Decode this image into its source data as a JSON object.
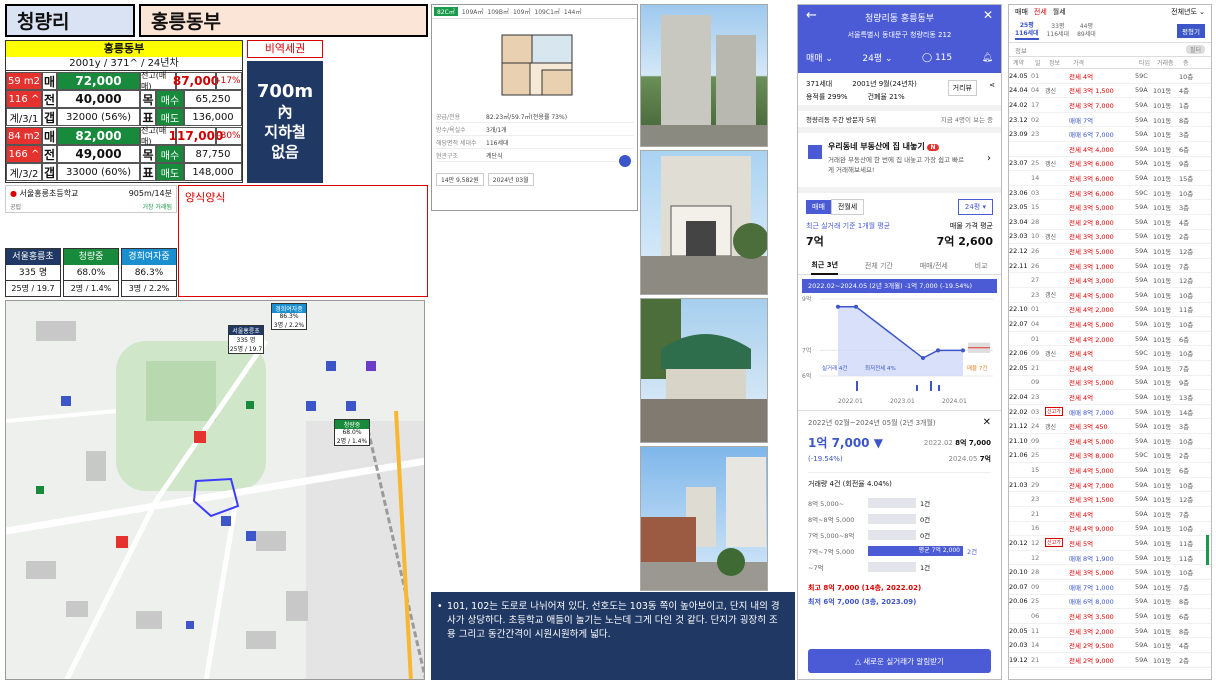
{
  "header": {
    "region": "청량리",
    "complex": "홍릉동부"
  },
  "summary": {
    "name": "홍릉동부",
    "info": "2001y / 371^ / 24년차",
    "tag_nonregulated": "비역세권",
    "station": {
      "line1": "700m",
      "line2": "內",
      "line3": "지하철",
      "line4": "없음"
    },
    "units": [
      {
        "size": "59 m2",
        "pyeong": "116 ^",
        "layout": "계/3/1",
        "sale_label": "매",
        "sale": "72,000",
        "jeonse_label": "전",
        "jeonse": "40,000",
        "gap_label": "갭",
        "gap": "32000 (56%)",
        "peak_label": "전고(매매)",
        "peak": "87,000",
        "peak_pct": "-17%",
        "target_label": "목",
        "ask_label": "매수",
        "ask": "65,250",
        "sell_target_label": "표",
        "sell_label": "매도",
        "sell": "136,000"
      },
      {
        "size": "84 m2",
        "pyeong": "166 ^",
        "layout": "계/3/2",
        "sale_label": "매",
        "sale": "82,000",
        "jeonse_label": "전",
        "jeonse": "49,000",
        "gap_label": "갭",
        "gap": "33000 (60%)",
        "peak_label": "전고(매매)",
        "peak": "117,000",
        "peak_pct": "-30%",
        "target_label": "목",
        "ask_label": "매수",
        "ask": "87,750",
        "sell_target_label": "표",
        "sell_label": "매도",
        "sell": "148,000"
      }
    ],
    "school_line": "서울홍릉초등학교",
    "school_dist": "905m/14분",
    "school_sub1": "공립",
    "school_sub2": "거창 거래됨",
    "note_title": "양식양식"
  },
  "schools": [
    {
      "name": "서울홍릉초",
      "v1": "335 명",
      "v2": "25명 / 19.7"
    },
    {
      "name": "청량중",
      "v1": "68.0%",
      "v2": "2명 / 1.4%"
    },
    {
      "name": "경희여자중",
      "v1": "86.3%",
      "v2": "3명 / 2.2%"
    }
  ],
  "map_labels": [
    {
      "name": "경희여자중",
      "v1": "86.3%",
      "v2": "3명 / 2.2%"
    },
    {
      "name": "서울홍릉초",
      "v1": "335 명",
      "v2": "25명 / 19.7"
    },
    {
      "name": "청량중",
      "v1": "68.0%",
      "v2": "2명 / 1.4%"
    }
  ],
  "floorplan": {
    "tabs": [
      "82C㎡",
      "109A㎡",
      "109B㎡",
      "109㎡",
      "109C1㎡",
      "144㎡"
    ],
    "row1_label": "공급/전용",
    "row1": "82.23㎡/59.7㎡(전용률 73%)",
    "row2_label": "방수/욕실수",
    "row2": "3개/1개",
    "row3_label": "해당면적 세대수",
    "row3": "116세대",
    "row4_label": "현관구조",
    "row4": "계단식",
    "btn1": "14만 9,582원",
    "btn2": "2024년 03월"
  },
  "note": {
    "text": "101, 102는 도로로 나뉘어져 있다. 선호도는 103동 쪽이 높아보이고, 단지 내의 경사가 상당하다. 초등학교 애들이 놀기는 노는데 그게 다인 것 같다. 단지가 굉장히 조용 그리고 동간간격이 시원시원하게 넓다."
  },
  "app": {
    "top_title": "청량리동 홍릉동부",
    "address": "서울특별시 동대문구 청량리동 212",
    "tab_trade": "매매",
    "tab_size": "24평",
    "comments": "115",
    "households": "371세대",
    "built": "2001년 9월(24년차)",
    "far": "용적률 299%",
    "bcr": "건폐율 21%",
    "review": "거리뷰",
    "visit": "청량리동 주간 방문자 5위",
    "visit_right": "지금 4명이 보는 중",
    "banner_title": "우리동네 부동산에 집 내놓기",
    "banner_badge": "N",
    "banner_sub": "거래완 부동산에 한 번에 집 내놓고 가장 쉽고 빠르게 거래해보세요!",
    "seg1": "매매",
    "seg2": "전월세",
    "size_sel": "24평",
    "recent_label": "최근 실거래 기준 1개월 평균",
    "recent_value": "7억",
    "ask_label": "매물 가격 평균",
    "ask_value": "7억 2,600",
    "tabs": [
      "최근 3년",
      "전체 기간",
      "매매/전세",
      "비교"
    ],
    "chart_caption": "2022.02~2024.05 (2년 3개월) -1억 7,000 (-19.54%)",
    "chart_legend1": "실거래 4건",
    "chart_legend2": "최저전세 4%",
    "chart_legend3": "매물 7건",
    "sheet_range": "2022년 02월~2024년 05월 (2년 3개월)",
    "sheet_diff": "1억 7,000 ▼",
    "sheet_pct": "(-19.54%)",
    "sheet_from_date": "2022.02",
    "sheet_from": "8억 7,000",
    "sheet_to_date": "2024.05",
    "sheet_to": "7억",
    "volume_label": "거래량 4건 (회전율 4.04%)",
    "dist": [
      {
        "label": "8억 5,000~",
        "cnt": "1건",
        "pct": 0.25
      },
      {
        "label": "8억~8억 5,000",
        "cnt": "0건",
        "pct": 0
      },
      {
        "label": "7억 5,000~8억",
        "cnt": "0건",
        "pct": 0
      },
      {
        "label": "7억~7억 5,000",
        "cnt": "2건",
        "pct": 0.5,
        "hl": "평균 7억 2,000"
      },
      {
        "label": "~7억",
        "cnt": "1건",
        "pct": 0.25
      }
    ],
    "max_line": "최고 8억 7,000 (14층, 2022.02)",
    "min_line": "최저 6억 7,000 (3층, 2023.09)",
    "alert_btn": "새로운 실거래가 알림받기"
  },
  "history": {
    "tabs": [
      "매매",
      "전세",
      "월세"
    ],
    "filter": "전체년도",
    "sizes": [
      {
        "top": "25평",
        "bot": "116세대"
      },
      {
        "top": "33평",
        "bot": "116세대"
      },
      {
        "top": "44평",
        "bot": "89세대"
      }
    ],
    "btn": "평형기",
    "subhead": "정보",
    "cols": [
      "계약",
      "일",
      "정보",
      "가격",
      "타입",
      "거래층",
      "층"
    ],
    "rows": [
      {
        "d": "24.05",
        "day": "01",
        "tag": "",
        "price": "전세 4억",
        "type": "59C",
        "dong": "",
        "fl": "10층"
      },
      {
        "d": "24.04",
        "day": "04",
        "tag": "갱신",
        "price": "전세 3억 1,500",
        "type": "59A",
        "dong": "101동",
        "fl": "4층"
      },
      {
        "d": "24.02",
        "day": "17",
        "tag": "",
        "price": "전세 3억 7,000",
        "type": "59A",
        "dong": "101동",
        "fl": "1층"
      },
      {
        "d": "23.12",
        "day": "02",
        "tag": "",
        "price": "매매 7억",
        "type": "59A",
        "dong": "101동",
        "fl": "8층"
      },
      {
        "d": "23.09",
        "day": "23",
        "tag": "",
        "price": "매매 6억 7,000",
        "type": "59A",
        "dong": "101동",
        "fl": "3층"
      },
      {
        "d": "",
        "day": "",
        "tag": "",
        "price": "전세 4억 4,000",
        "type": "59A",
        "dong": "101동",
        "fl": "6층"
      },
      {
        "d": "23.07",
        "day": "25",
        "tag": "갱신",
        "price": "전세 3억 6,000",
        "type": "59A",
        "dong": "101동",
        "fl": "9층"
      },
      {
        "d": "",
        "day": "14",
        "tag": "",
        "price": "전세 3억 6,000",
        "type": "59A",
        "dong": "101동",
        "fl": "15층"
      },
      {
        "d": "23.06",
        "day": "03",
        "tag": "",
        "price": "전세 3억 6,000",
        "type": "59C",
        "dong": "101동",
        "fl": "10층"
      },
      {
        "d": "23.05",
        "day": "15",
        "tag": "",
        "price": "전세 3억 5,000",
        "type": "59A",
        "dong": "101동",
        "fl": "3층"
      },
      {
        "d": "23.04",
        "day": "28",
        "tag": "",
        "price": "전세 2억 8,000",
        "type": "59A",
        "dong": "101동",
        "fl": "4층"
      },
      {
        "d": "23.03",
        "day": "10",
        "tag": "갱신",
        "price": "전세 3억 3,000",
        "type": "59A",
        "dong": "101동",
        "fl": "2층"
      },
      {
        "d": "22.12",
        "day": "26",
        "tag": "",
        "price": "전세 3억 5,000",
        "type": "59A",
        "dong": "101동",
        "fl": "12층"
      },
      {
        "d": "22.11",
        "day": "26",
        "tag": "",
        "price": "전세 3억 1,000",
        "type": "59A",
        "dong": "101동",
        "fl": "7층"
      },
      {
        "d": "",
        "day": "27",
        "tag": "",
        "price": "전세 4억 3,000",
        "type": "59A",
        "dong": "101동",
        "fl": "12층"
      },
      {
        "d": "",
        "day": "23",
        "tag": "갱신",
        "price": "전세 4억 5,000",
        "type": "59A",
        "dong": "101동",
        "fl": "10층"
      },
      {
        "d": "22.10",
        "day": "01",
        "tag": "",
        "price": "전세 4억 2,000",
        "type": "59A",
        "dong": "101동",
        "fl": "11층"
      },
      {
        "d": "22.07",
        "day": "04",
        "tag": "",
        "price": "전세 4억 5,000",
        "type": "59A",
        "dong": "101동",
        "fl": "10층"
      },
      {
        "d": "",
        "day": "01",
        "tag": "",
        "price": "전세 4억 2,000",
        "type": "59A",
        "dong": "101동",
        "fl": "6층"
      },
      {
        "d": "22.06",
        "day": "09",
        "tag": "갱신",
        "price": "전세 4억",
        "type": "59C",
        "dong": "101동",
        "fl": "10층"
      },
      {
        "d": "22.05",
        "day": "21",
        "tag": "",
        "price": "전세 4억",
        "type": "59A",
        "dong": "101동",
        "fl": "7층"
      },
      {
        "d": "",
        "day": "09",
        "tag": "",
        "price": "전세 3억 5,000",
        "type": "59A",
        "dong": "101동",
        "fl": "9층"
      },
      {
        "d": "22.04",
        "day": "23",
        "tag": "",
        "price": "전세 4억",
        "type": "59A",
        "dong": "101동",
        "fl": "13층"
      },
      {
        "d": "22.02",
        "day": "03",
        "tag": "신고가",
        "price": "매매 8억 7,000",
        "type": "59A",
        "dong": "101동",
        "fl": "14층"
      },
      {
        "d": "21.12",
        "day": "24",
        "tag": "갱신",
        "price": "전세 3억 450",
        "type": "59A",
        "dong": "101동",
        "fl": "3층"
      },
      {
        "d": "21.10",
        "day": "09",
        "tag": "",
        "price": "전세 4억 5,000",
        "type": "59A",
        "dong": "101동",
        "fl": "10층"
      },
      {
        "d": "21.06",
        "day": "25",
        "tag": "",
        "price": "전세 3억 8,000",
        "type": "59C",
        "dong": "101동",
        "fl": "2층"
      },
      {
        "d": "",
        "day": "15",
        "tag": "",
        "price": "전세 4억 5,000",
        "type": "59A",
        "dong": "101동",
        "fl": "6층"
      },
      {
        "d": "21.03",
        "day": "29",
        "tag": "",
        "price": "전세 4억 7,000",
        "type": "59A",
        "dong": "101동",
        "fl": "10층"
      },
      {
        "d": "",
        "day": "23",
        "tag": "",
        "price": "전세 3억 1,500",
        "type": "59A",
        "dong": "101동",
        "fl": "12층"
      },
      {
        "d": "",
        "day": "21",
        "tag": "",
        "price": "전세 4억",
        "type": "59A",
        "dong": "101동",
        "fl": "7층"
      },
      {
        "d": "",
        "day": "16",
        "tag": "",
        "price": "전세 4억 9,000",
        "type": "59A",
        "dong": "101동",
        "fl": "10층"
      },
      {
        "d": "20.12",
        "day": "12",
        "tag": "신고가",
        "price": "전세 5억",
        "type": "59A",
        "dong": "101동",
        "fl": "11층"
      },
      {
        "d": "",
        "day": "12",
        "tag": "",
        "price": "매매 8억 1,900",
        "type": "59A",
        "dong": "101동",
        "fl": "11층"
      },
      {
        "d": "20.10",
        "day": "28",
        "tag": "",
        "price": "전세 3억 5,000",
        "type": "59A",
        "dong": "101동",
        "fl": "10층"
      },
      {
        "d": "20.07",
        "day": "09",
        "tag": "",
        "price": "매매 7억 1,000",
        "type": "59A",
        "dong": "101동",
        "fl": "7층"
      },
      {
        "d": "20.06",
        "day": "25",
        "tag": "",
        "price": "매매 6억 8,000",
        "type": "59A",
        "dong": "101동",
        "fl": "8층"
      },
      {
        "d": "",
        "day": "06",
        "tag": "",
        "price": "전세 3억 3,500",
        "type": "59A",
        "dong": "101동",
        "fl": "6층"
      },
      {
        "d": "20.05",
        "day": "11",
        "tag": "",
        "price": "전세 3억 2,000",
        "type": "59A",
        "dong": "101동",
        "fl": "8층"
      },
      {
        "d": "20.03",
        "day": "14",
        "tag": "",
        "price": "전세 2억 9,500",
        "type": "59A",
        "dong": "101동",
        "fl": "4층"
      },
      {
        "d": "19.12",
        "day": "21",
        "tag": "",
        "price": "전세 2억 9,000",
        "type": "59A",
        "dong": "101동",
        "fl": "2층"
      }
    ]
  },
  "chart_data": {
    "type": "line",
    "x": [
      "2022.02",
      "2022.04",
      "2023.09",
      "2023.12",
      "2024.05"
    ],
    "series": [
      {
        "values": [
          8.7,
          8.7,
          6.7,
          7.0,
          7.0
        ]
      }
    ],
    "ylabel": "",
    "ylim": [
      6,
      9
    ],
    "yticks": [
      "9억",
      "7억",
      "6억"
    ],
    "xticks": [
      "2022.01",
      "2023.01",
      "2024.01"
    ]
  }
}
